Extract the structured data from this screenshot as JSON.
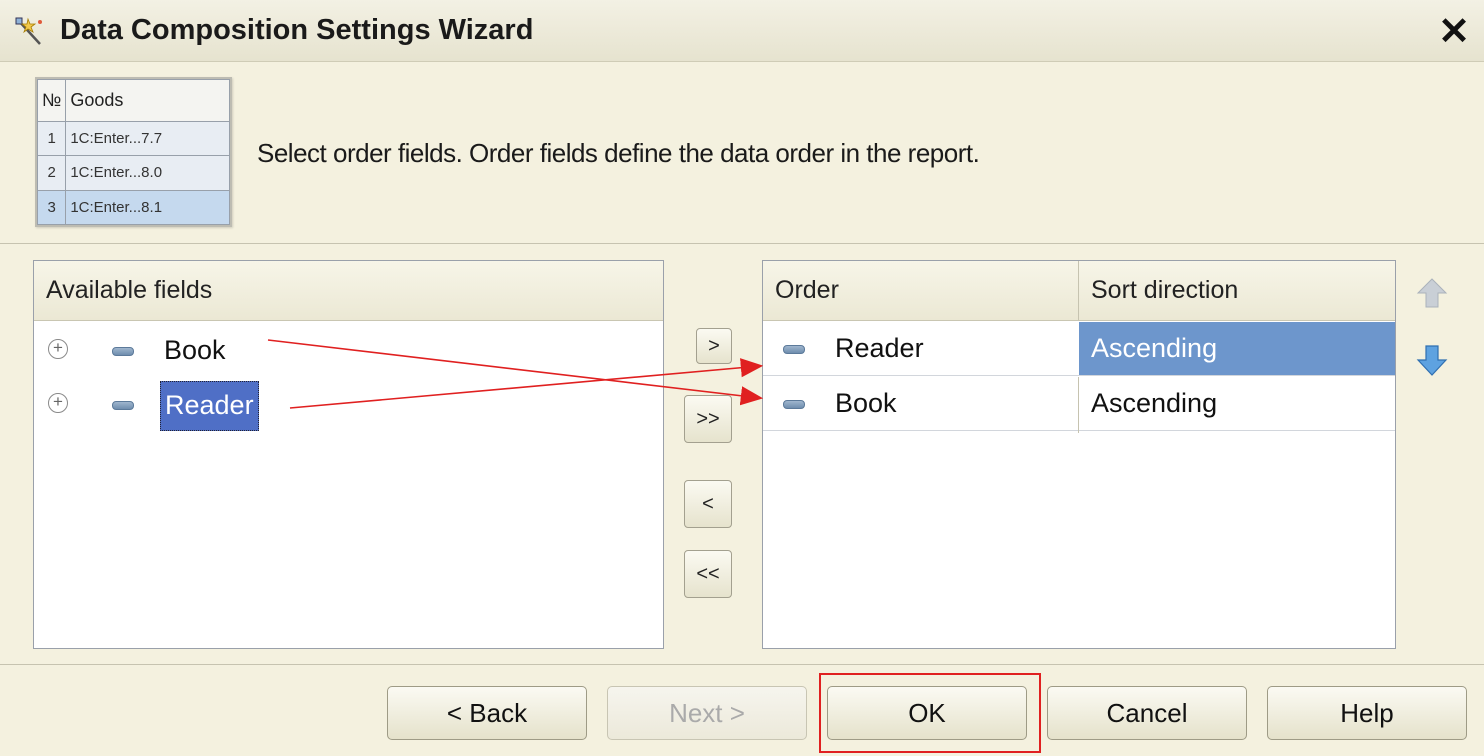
{
  "window": {
    "title": "Data Composition Settings Wizard",
    "close_glyph": "✕"
  },
  "header": {
    "instruction": "Select order fields. Order fields define the data order in the report.",
    "thumbnail": {
      "col_num": "№",
      "col_goods": "Goods",
      "rows": [
        {
          "num": "1",
          "goods": "1C:Enter...7.7"
        },
        {
          "num": "2",
          "goods": "1C:Enter...8.0"
        },
        {
          "num": "3",
          "goods": "1C:Enter...8.1"
        }
      ]
    }
  },
  "available": {
    "header": "Available fields",
    "items": [
      {
        "label": "Book",
        "selected": false
      },
      {
        "label": "Reader",
        "selected": true
      }
    ]
  },
  "transfer": {
    "add": ">",
    "add_all": ">>",
    "remove": "<",
    "remove_all": "<<"
  },
  "order": {
    "col_field": "Order",
    "col_direction": "Sort direction",
    "rows": [
      {
        "field": "Reader",
        "direction": "Ascending",
        "selected": true
      },
      {
        "field": "Book",
        "direction": "Ascending",
        "selected": false
      }
    ]
  },
  "side_icons": {
    "up": "arrow-up-icon",
    "down": "arrow-down-icon"
  },
  "footer": {
    "back": "< Back",
    "next": "Next >",
    "ok": "OK",
    "cancel": "Cancel",
    "help": "Help"
  },
  "colors": {
    "selection": "#4f6fc6",
    "highlight_selection": "#6d96cc",
    "annotation": "#e02020"
  }
}
